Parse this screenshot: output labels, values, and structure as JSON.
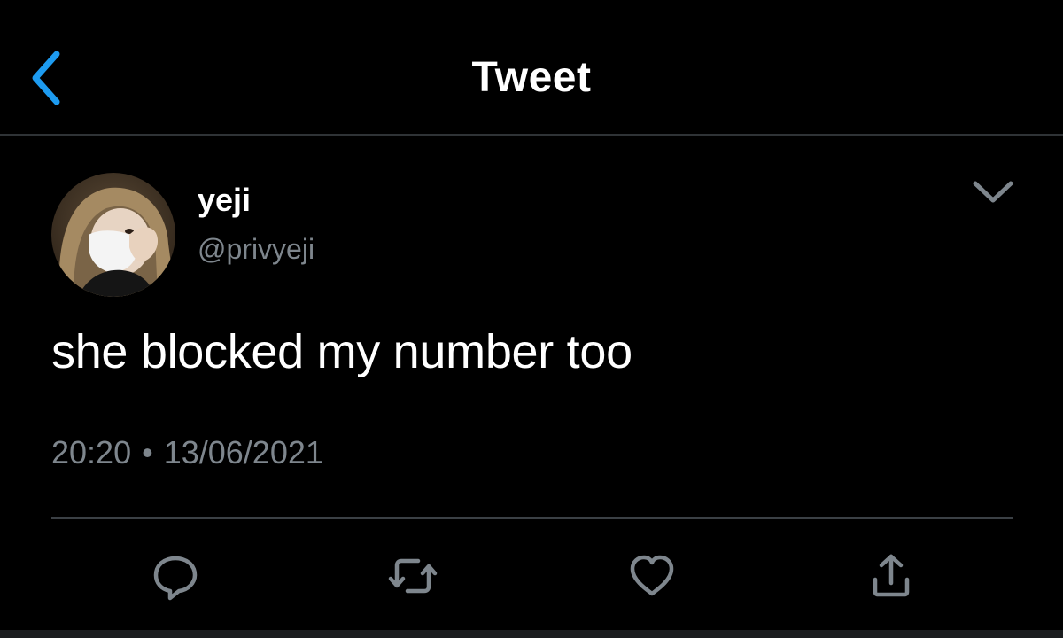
{
  "header": {
    "title": "Tweet",
    "back_icon": "chevron-left-icon"
  },
  "tweet": {
    "author": {
      "display_name": "yeji",
      "handle": "@privyeji"
    },
    "text": "she blocked my number too",
    "time": "20:20",
    "separator": "•",
    "date": "13/06/2021"
  },
  "actions": [
    {
      "name": "reply",
      "icon": "reply-icon"
    },
    {
      "name": "retweet",
      "icon": "retweet-icon"
    },
    {
      "name": "like",
      "icon": "heart-icon"
    },
    {
      "name": "share",
      "icon": "share-icon"
    }
  ],
  "colors": {
    "accent": "#1d9bf0",
    "muted": "#7e868d",
    "background": "#000000",
    "divider": "#2f3336"
  }
}
